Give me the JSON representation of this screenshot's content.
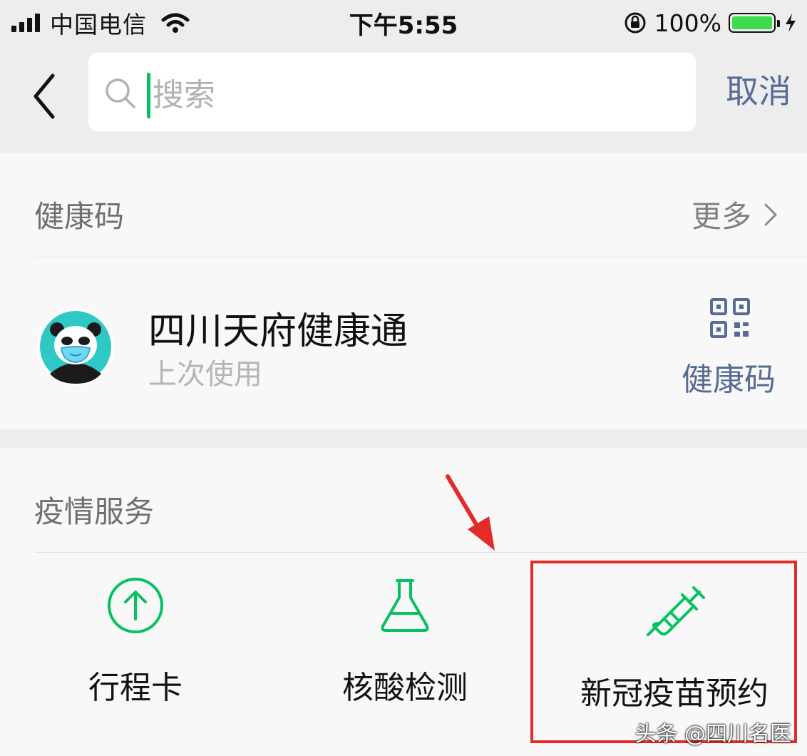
{
  "status_bar": {
    "carrier": "中国电信",
    "time": "下午5:55",
    "battery_percent": "100%",
    "battery_level": 1.0,
    "icons": [
      "signal-icon",
      "wifi-icon",
      "orientation-lock-icon",
      "battery-icon",
      "charging-icon"
    ]
  },
  "search": {
    "placeholder": "搜索",
    "cancel_label": "取消",
    "back_icon": "chevron-left-icon",
    "search_icon": "search-icon"
  },
  "health_code_section": {
    "title": "健康码",
    "more_label": "更多",
    "app": {
      "name": "四川天府健康通",
      "subtitle": "上次使用",
      "action_label": "健康码",
      "action_icon": "qr-code-icon"
    }
  },
  "epidemic_section": {
    "title": "疫情服务",
    "services": [
      {
        "label": "行程卡",
        "icon": "arrow-up-circle-icon"
      },
      {
        "label": "核酸检测",
        "icon": "flask-icon"
      },
      {
        "label": "新冠疫苗预约",
        "icon": "syringe-icon"
      }
    ]
  },
  "annotation": {
    "watermark": "头条 @四川名医"
  },
  "colors": {
    "accent_green": "#07c160",
    "link_blue": "#576b95",
    "highlight_red": "#e52a2a",
    "page_bg": "#ededed",
    "card_bg": "#f8f8f8"
  }
}
